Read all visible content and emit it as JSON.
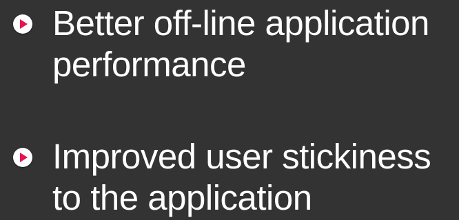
{
  "colors": {
    "background": "#333333",
    "text": "#ffffff",
    "bullet_accent": "#e8124c"
  },
  "bullets": [
    {
      "icon": "play-circle-icon",
      "line1": "Better off-line application",
      "line2": "performance"
    },
    {
      "icon": "play-circle-icon",
      "line1": "Improved user stickiness",
      "line2": "to the application"
    }
  ]
}
